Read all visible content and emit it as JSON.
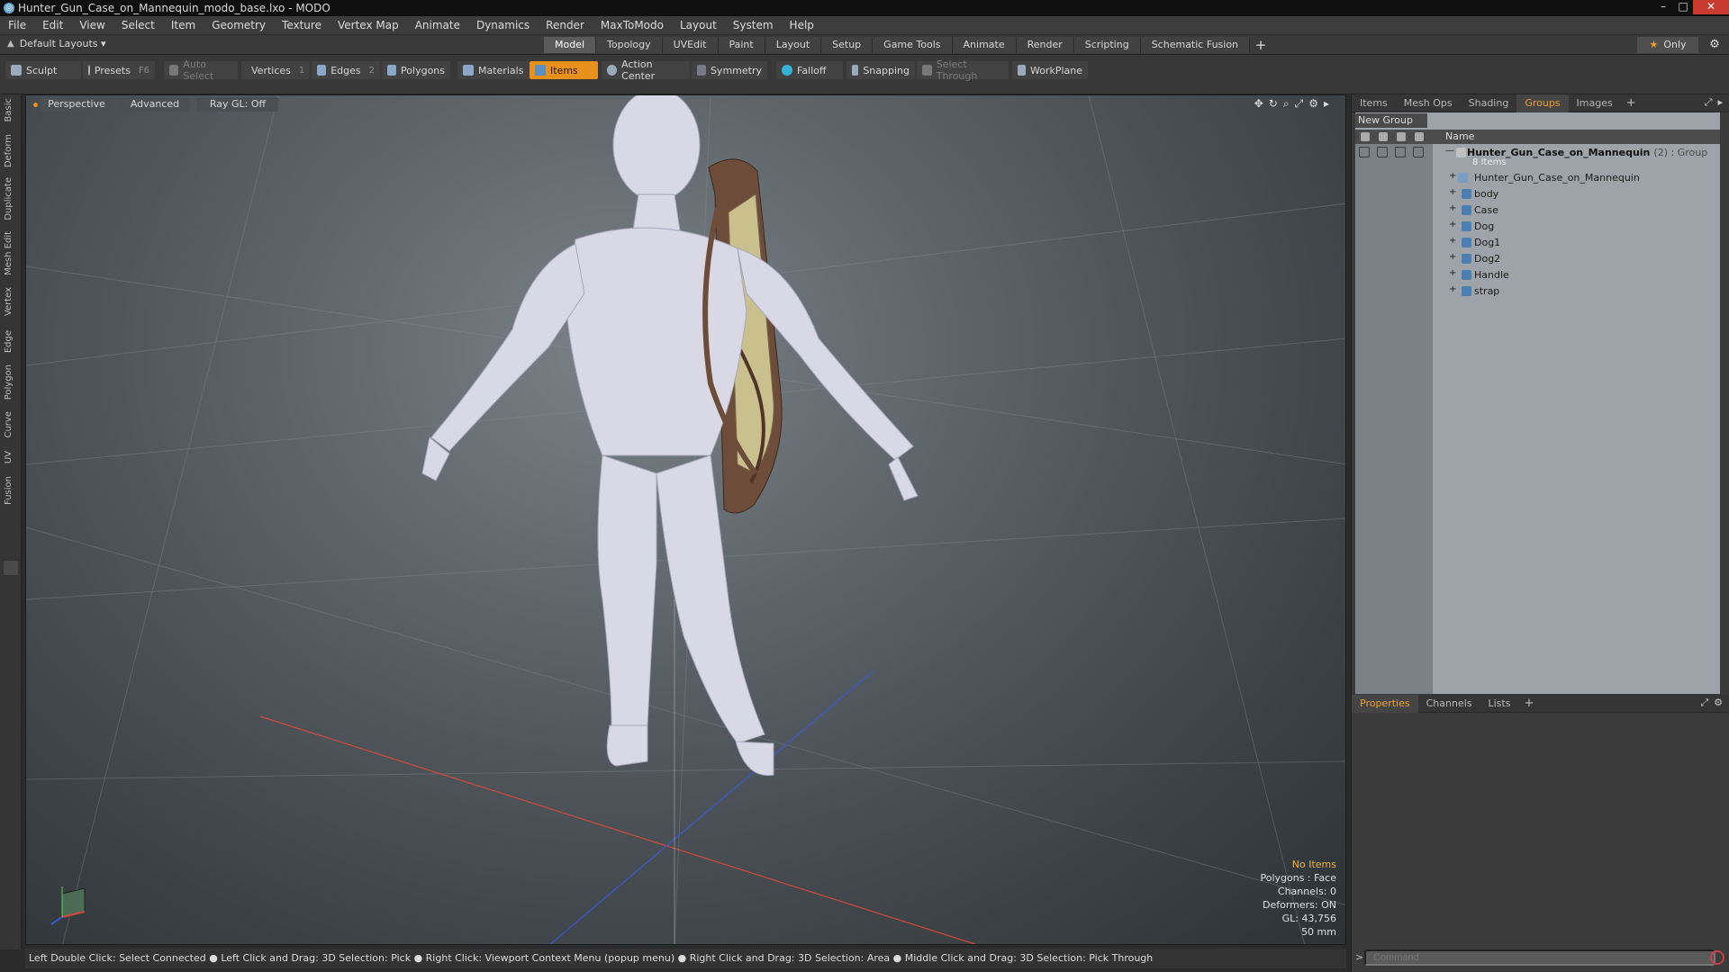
{
  "window": {
    "title": "Hunter_Gun_Case_on_Mannequin_modo_base.lxo - MODO",
    "minimize": "–",
    "maximize": "□",
    "close": "✕"
  },
  "menu": [
    "File",
    "Edit",
    "View",
    "Select",
    "Item",
    "Geometry",
    "Texture",
    "Vertex Map",
    "Animate",
    "Dynamics",
    "Render",
    "MaxToModo",
    "Layout",
    "System",
    "Help"
  ],
  "layoutbar": {
    "selector": "Default Layouts ▾",
    "tabs": [
      "Model",
      "Topology",
      "UVEdit",
      "Paint",
      "Layout",
      "Setup",
      "Game Tools",
      "Animate",
      "Render",
      "Scripting",
      "Schematic Fusion"
    ],
    "active_tab": "Model",
    "plus": "+",
    "only": "Only",
    "gear": "⚙"
  },
  "toolbar": {
    "sculpt": "Sculpt",
    "presets": "Presets",
    "presets_key": "F6",
    "auto_select": "Auto Select",
    "vertices": "Vertices",
    "vertices_count": "1",
    "edges": "Edges",
    "edges_count": "2",
    "polygons": "Polygons",
    "materials": "Materials",
    "items": "Items",
    "action_center": "Action Center",
    "symmetry": "Symmetry",
    "falloff": "Falloff",
    "snapping": "Snapping",
    "select_through": "Select Through",
    "workplane": "WorkPlane"
  },
  "left_tabs": [
    "Basic",
    "Deform",
    "Duplicate",
    "Mesh Edit",
    "Vertex",
    "Edge",
    "Polygon",
    "Curve",
    "UV",
    "Fusion"
  ],
  "viewport": {
    "view": "Perspective",
    "advanced": "Advanced",
    "raygl": "Ray GL: Off",
    "icons": [
      "✥",
      "↻",
      "⌕",
      "⤢",
      "⚙",
      "▸"
    ],
    "stats": {
      "no_items": "No Items",
      "polygons": "Polygons : Face",
      "channels": "Channels: 0",
      "deformers": "Deformers: ON",
      "gl": "GL: 43,756",
      "scale": "50 mm"
    }
  },
  "statusbar": "Left Double Click: Select Connected ● Left Click and Drag: 3D Selection: Pick ● Right Click: Viewport Context Menu (popup menu) ● Right Click and Drag: 3D Selection: Area ● Middle Click and Drag: 3D Selection: Pick Through",
  "right_panel": {
    "tabs": [
      "Items",
      "Mesh Ops",
      "Shading",
      "Groups",
      "Images"
    ],
    "active_tab": "Groups",
    "plus": "+",
    "new_group": "New Group",
    "column_name": "Name",
    "group": {
      "name": "Hunter_Gun_Case_on_Mannequin",
      "suffix": "(2) : Group",
      "count": "8 Items"
    },
    "items": [
      "Hunter_Gun_Case_on_Mannequin",
      "body",
      "Case",
      "Dog",
      "Dog1",
      "Dog2",
      "Handle",
      "strap"
    ],
    "props_tabs": [
      "Properties",
      "Channels",
      "Lists"
    ],
    "props_active": "Properties",
    "command_placeholder": "Command"
  },
  "colors": {
    "accent": "#e8901c",
    "axis_x": "#d04a3a",
    "axis_z": "#3a5ad0",
    "axis_y": "#5ad05a"
  }
}
